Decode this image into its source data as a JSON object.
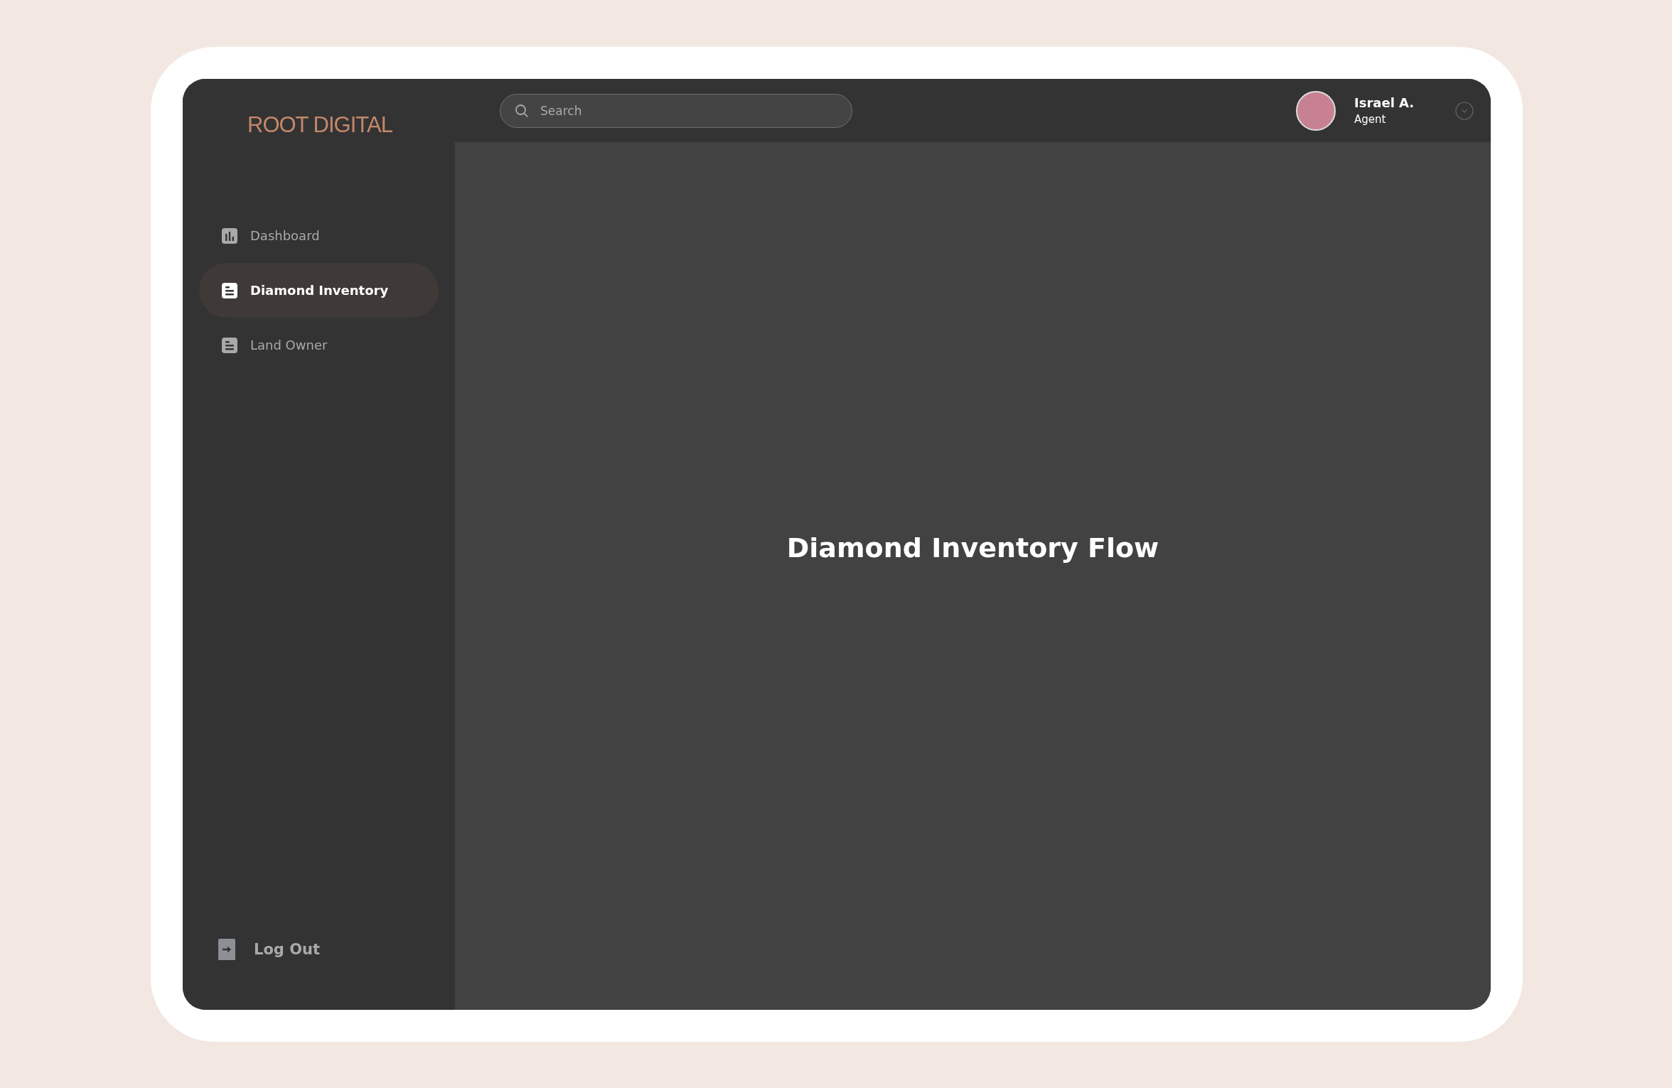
{
  "sidebar": {
    "logo": "ROOT DIGITAL",
    "items": [
      {
        "label": "Dashboard",
        "kind": "chart",
        "selected": false
      },
      {
        "label": "Diamond Inventory",
        "kind": "list",
        "selected": true
      },
      {
        "label": "Land Owner",
        "kind": "list",
        "selected": false
      }
    ],
    "logout": "Log Out"
  },
  "topbar": {
    "search": {
      "placeholder": "Search"
    },
    "user": {
      "name": "Israel A.",
      "role": "Agent"
    }
  },
  "main": {
    "title": "Diamond Inventory Flow"
  }
}
